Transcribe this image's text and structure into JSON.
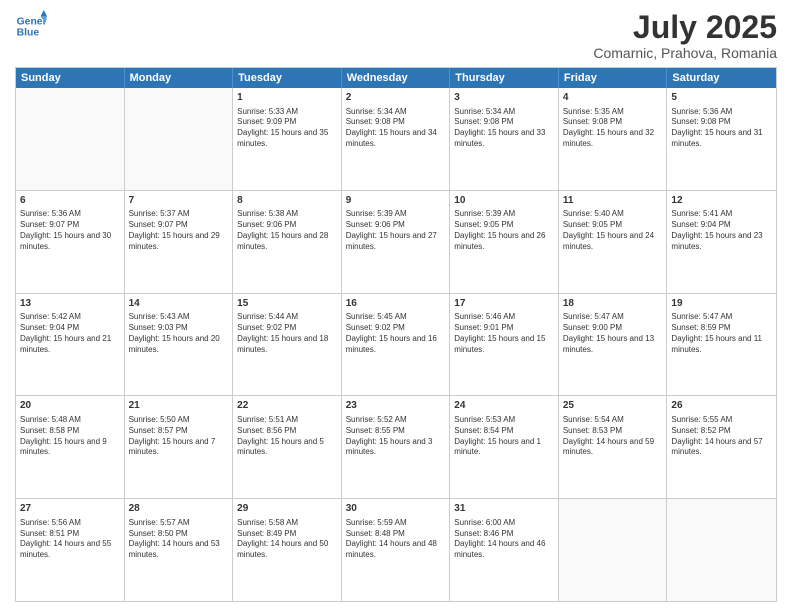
{
  "header": {
    "logo_line1": "General",
    "logo_line2": "Blue",
    "month": "July 2025",
    "location": "Comarnic, Prahova, Romania"
  },
  "weekdays": [
    "Sunday",
    "Monday",
    "Tuesday",
    "Wednesday",
    "Thursday",
    "Friday",
    "Saturday"
  ],
  "rows": [
    [
      {
        "day": "",
        "sunrise": "",
        "sunset": "",
        "daylight": ""
      },
      {
        "day": "",
        "sunrise": "",
        "sunset": "",
        "daylight": ""
      },
      {
        "day": "1",
        "sunrise": "Sunrise: 5:33 AM",
        "sunset": "Sunset: 9:09 PM",
        "daylight": "Daylight: 15 hours and 35 minutes."
      },
      {
        "day": "2",
        "sunrise": "Sunrise: 5:34 AM",
        "sunset": "Sunset: 9:08 PM",
        "daylight": "Daylight: 15 hours and 34 minutes."
      },
      {
        "day": "3",
        "sunrise": "Sunrise: 5:34 AM",
        "sunset": "Sunset: 9:08 PM",
        "daylight": "Daylight: 15 hours and 33 minutes."
      },
      {
        "day": "4",
        "sunrise": "Sunrise: 5:35 AM",
        "sunset": "Sunset: 9:08 PM",
        "daylight": "Daylight: 15 hours and 32 minutes."
      },
      {
        "day": "5",
        "sunrise": "Sunrise: 5:36 AM",
        "sunset": "Sunset: 9:08 PM",
        "daylight": "Daylight: 15 hours and 31 minutes."
      }
    ],
    [
      {
        "day": "6",
        "sunrise": "Sunrise: 5:36 AM",
        "sunset": "Sunset: 9:07 PM",
        "daylight": "Daylight: 15 hours and 30 minutes."
      },
      {
        "day": "7",
        "sunrise": "Sunrise: 5:37 AM",
        "sunset": "Sunset: 9:07 PM",
        "daylight": "Daylight: 15 hours and 29 minutes."
      },
      {
        "day": "8",
        "sunrise": "Sunrise: 5:38 AM",
        "sunset": "Sunset: 9:06 PM",
        "daylight": "Daylight: 15 hours and 28 minutes."
      },
      {
        "day": "9",
        "sunrise": "Sunrise: 5:39 AM",
        "sunset": "Sunset: 9:06 PM",
        "daylight": "Daylight: 15 hours and 27 minutes."
      },
      {
        "day": "10",
        "sunrise": "Sunrise: 5:39 AM",
        "sunset": "Sunset: 9:05 PM",
        "daylight": "Daylight: 15 hours and 26 minutes."
      },
      {
        "day": "11",
        "sunrise": "Sunrise: 5:40 AM",
        "sunset": "Sunset: 9:05 PM",
        "daylight": "Daylight: 15 hours and 24 minutes."
      },
      {
        "day": "12",
        "sunrise": "Sunrise: 5:41 AM",
        "sunset": "Sunset: 9:04 PM",
        "daylight": "Daylight: 15 hours and 23 minutes."
      }
    ],
    [
      {
        "day": "13",
        "sunrise": "Sunrise: 5:42 AM",
        "sunset": "Sunset: 9:04 PM",
        "daylight": "Daylight: 15 hours and 21 minutes."
      },
      {
        "day": "14",
        "sunrise": "Sunrise: 5:43 AM",
        "sunset": "Sunset: 9:03 PM",
        "daylight": "Daylight: 15 hours and 20 minutes."
      },
      {
        "day": "15",
        "sunrise": "Sunrise: 5:44 AM",
        "sunset": "Sunset: 9:02 PM",
        "daylight": "Daylight: 15 hours and 18 minutes."
      },
      {
        "day": "16",
        "sunrise": "Sunrise: 5:45 AM",
        "sunset": "Sunset: 9:02 PM",
        "daylight": "Daylight: 15 hours and 16 minutes."
      },
      {
        "day": "17",
        "sunrise": "Sunrise: 5:46 AM",
        "sunset": "Sunset: 9:01 PM",
        "daylight": "Daylight: 15 hours and 15 minutes."
      },
      {
        "day": "18",
        "sunrise": "Sunrise: 5:47 AM",
        "sunset": "Sunset: 9:00 PM",
        "daylight": "Daylight: 15 hours and 13 minutes."
      },
      {
        "day": "19",
        "sunrise": "Sunrise: 5:47 AM",
        "sunset": "Sunset: 8:59 PM",
        "daylight": "Daylight: 15 hours and 11 minutes."
      }
    ],
    [
      {
        "day": "20",
        "sunrise": "Sunrise: 5:48 AM",
        "sunset": "Sunset: 8:58 PM",
        "daylight": "Daylight: 15 hours and 9 minutes."
      },
      {
        "day": "21",
        "sunrise": "Sunrise: 5:50 AM",
        "sunset": "Sunset: 8:57 PM",
        "daylight": "Daylight: 15 hours and 7 minutes."
      },
      {
        "day": "22",
        "sunrise": "Sunrise: 5:51 AM",
        "sunset": "Sunset: 8:56 PM",
        "daylight": "Daylight: 15 hours and 5 minutes."
      },
      {
        "day": "23",
        "sunrise": "Sunrise: 5:52 AM",
        "sunset": "Sunset: 8:55 PM",
        "daylight": "Daylight: 15 hours and 3 minutes."
      },
      {
        "day": "24",
        "sunrise": "Sunrise: 5:53 AM",
        "sunset": "Sunset: 8:54 PM",
        "daylight": "Daylight: 15 hours and 1 minute."
      },
      {
        "day": "25",
        "sunrise": "Sunrise: 5:54 AM",
        "sunset": "Sunset: 8:53 PM",
        "daylight": "Daylight: 14 hours and 59 minutes."
      },
      {
        "day": "26",
        "sunrise": "Sunrise: 5:55 AM",
        "sunset": "Sunset: 8:52 PM",
        "daylight": "Daylight: 14 hours and 57 minutes."
      }
    ],
    [
      {
        "day": "27",
        "sunrise": "Sunrise: 5:56 AM",
        "sunset": "Sunset: 8:51 PM",
        "daylight": "Daylight: 14 hours and 55 minutes."
      },
      {
        "day": "28",
        "sunrise": "Sunrise: 5:57 AM",
        "sunset": "Sunset: 8:50 PM",
        "daylight": "Daylight: 14 hours and 53 minutes."
      },
      {
        "day": "29",
        "sunrise": "Sunrise: 5:58 AM",
        "sunset": "Sunset: 8:49 PM",
        "daylight": "Daylight: 14 hours and 50 minutes."
      },
      {
        "day": "30",
        "sunrise": "Sunrise: 5:59 AM",
        "sunset": "Sunset: 8:48 PM",
        "daylight": "Daylight: 14 hours and 48 minutes."
      },
      {
        "day": "31",
        "sunrise": "Sunrise: 6:00 AM",
        "sunset": "Sunset: 8:46 PM",
        "daylight": "Daylight: 14 hours and 46 minutes."
      },
      {
        "day": "",
        "sunrise": "",
        "sunset": "",
        "daylight": ""
      },
      {
        "day": "",
        "sunrise": "",
        "sunset": "",
        "daylight": ""
      }
    ]
  ]
}
